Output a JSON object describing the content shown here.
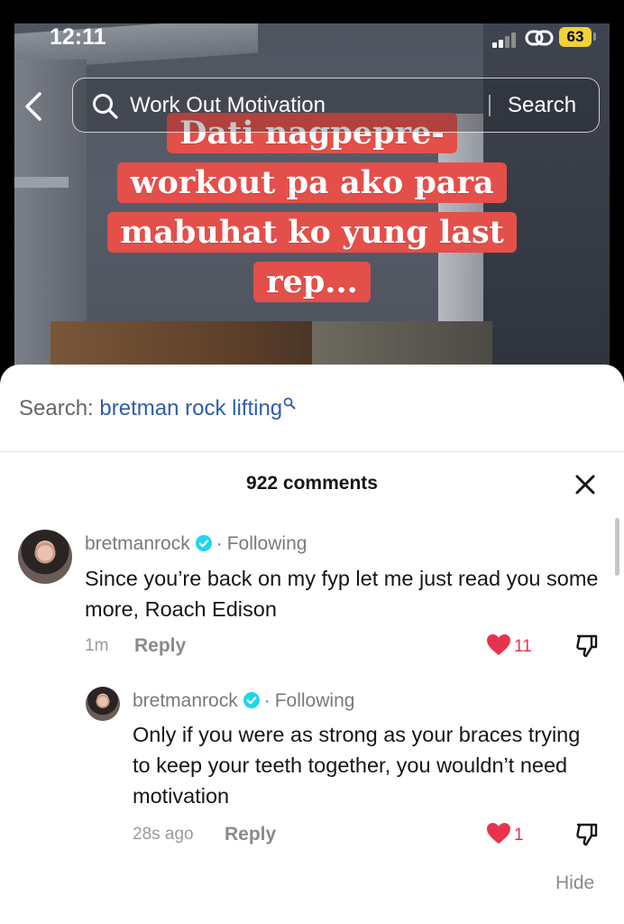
{
  "status_bar": {
    "time": "12:11",
    "battery": "63"
  },
  "search": {
    "query": "Work Out Motivation",
    "button_label": "Search"
  },
  "video": {
    "caption_lines": [
      "Dati nagpepre-",
      "workout pa ako para",
      "mabuhat ko yung last",
      "rep..."
    ]
  },
  "related_search": {
    "label": "Search:",
    "query": "bretman rock lifting"
  },
  "comments_panel": {
    "count_label": "922 comments",
    "hide_label": "Hide",
    "comments": [
      {
        "username": "bretmanrock",
        "relation": "Following",
        "text": "Since you’re back on my fyp let me just read you some more, Roach Edison",
        "time": "1m",
        "reply_label": "Reply",
        "likes": "11"
      },
      {
        "username": "bretmanrock",
        "relation": "Following",
        "text": "Only if you were as strong as your braces trying to keep your teeth together, you wouldn’t need motivation",
        "time": "28s ago",
        "reply_label": "Reply",
        "likes": "1"
      }
    ]
  },
  "colors": {
    "accent_like": "#e8334d",
    "verified": "#20d5ec",
    "caption_bg": "#e44f4a",
    "link": "#2f5ea8"
  },
  "icons": [
    "back-icon",
    "search-icon",
    "close-icon",
    "heart-icon",
    "dislike-icon",
    "verified-icon",
    "link-icon"
  ]
}
